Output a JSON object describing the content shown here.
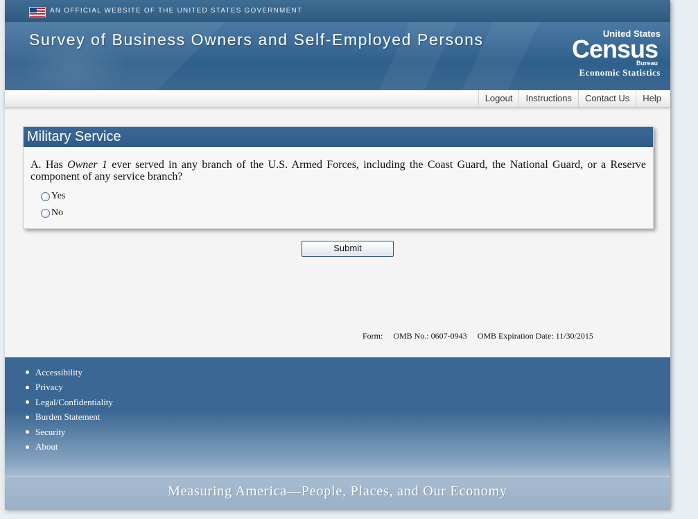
{
  "gov_banner": {
    "text": "AN OFFICIAL WEBSITE OF THE UNITED STATES GOVERNMENT"
  },
  "header": {
    "title": "Survey of Business Owners and Self-Employed Persons",
    "logo": {
      "line1": "United States",
      "line2": "Census",
      "line3": "Bureau",
      "line4": "Economic Statistics"
    }
  },
  "nav": {
    "items": [
      "Logout",
      "Instructions",
      "Contact Us",
      "Help"
    ]
  },
  "section": {
    "title": "Military Service",
    "question": {
      "prefix": "A. Has ",
      "owner": "Owner 1",
      "suffix": " ever served in any branch of the U.S. Armed Forces, including the Coast Guard, the National Guard, or a Reserve component of any service branch?"
    },
    "options": [
      "Yes",
      "No"
    ]
  },
  "submit_label": "Submit",
  "omb": {
    "form": "Form:",
    "number": "OMB No.: 0607-0943",
    "expiration": "OMB Expiration Date: 11/30/2015"
  },
  "footer": {
    "links": [
      "Accessibility",
      "Privacy",
      "Legal/Confidentiality",
      "Burden Statement",
      "Security",
      "About"
    ],
    "tagline": "Measuring America—People, Places, and Our Economy"
  },
  "colors": {
    "header_blue": "#2f5f8c",
    "panel_title_blue": "#2e5b87",
    "footer_blue": "#3a6793"
  }
}
